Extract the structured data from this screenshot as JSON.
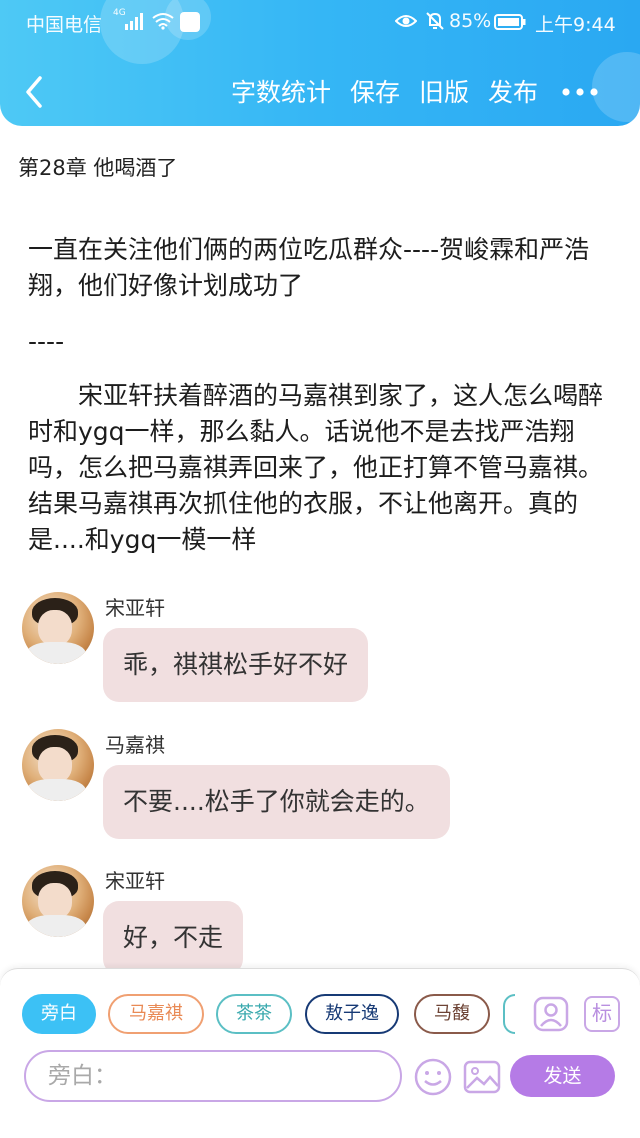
{
  "status_bar": {
    "carrier": "中国电信",
    "network": "4G",
    "battery": "85%",
    "time": "上午9:44"
  },
  "toolbar": {
    "word_count": "字数统计",
    "save": "保存",
    "old_version": "旧版",
    "publish": "发布"
  },
  "chapter": {
    "title": "第28章 他喝酒了"
  },
  "narration": {
    "p1": "一直在关注他们俩的两位吃瓜群众----贺峻霖和严浩翔，他们好像计划成功了",
    "separator": "----",
    "p2": "　　宋亚轩扶着醉酒的马嘉祺到家了，这人怎么喝醉时和ygq一样，那么黏人。话说他不是去找严浩翔吗，怎么把马嘉祺弄回来了，他正打算不管马嘉祺。结果马嘉祺再次抓住他的衣服，不让他离开。真的是....和ygq一模一样"
  },
  "messages": [
    {
      "speaker": "宋亚轩",
      "text": "乖，祺祺松手好不好"
    },
    {
      "speaker": "马嘉祺",
      "text": "不要....松手了你就会走的。"
    },
    {
      "speaker": "宋亚轩",
      "text": "好，不走"
    }
  ],
  "roles": [
    "旁白",
    "马嘉祺",
    "茶茶",
    "敖子逸",
    "马馥"
  ],
  "composer": {
    "placeholder": "旁白：",
    "send": "发送",
    "mark_label": "标"
  },
  "colors": {
    "header": "#35b6f5",
    "active_role": "#3cc1f5",
    "bubble": "#f1dfe0",
    "send_button": "#b57be6",
    "input_border": "#c9a7e6"
  }
}
